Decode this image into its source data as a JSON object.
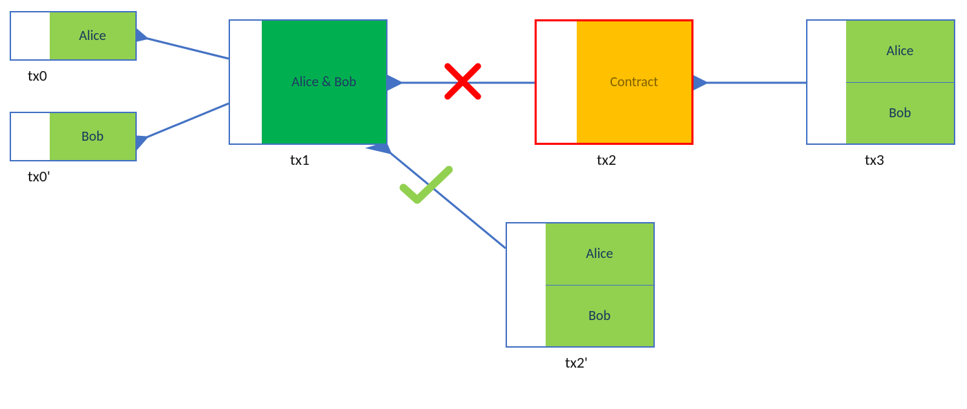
{
  "tx0_alice": {
    "label": "tx0",
    "cell": "Alice"
  },
  "tx0_bob": {
    "label": "tx0'",
    "cell": "Bob"
  },
  "tx1": {
    "label": "tx1",
    "cell": "Alice & Bob"
  },
  "tx2": {
    "label": "tx2",
    "cell": "Contract"
  },
  "tx2p": {
    "label": "tx2'",
    "top": "Alice",
    "bottom": "Bob"
  },
  "tx3": {
    "label": "tx3",
    "top": "Alice",
    "bottom": "Bob"
  }
}
